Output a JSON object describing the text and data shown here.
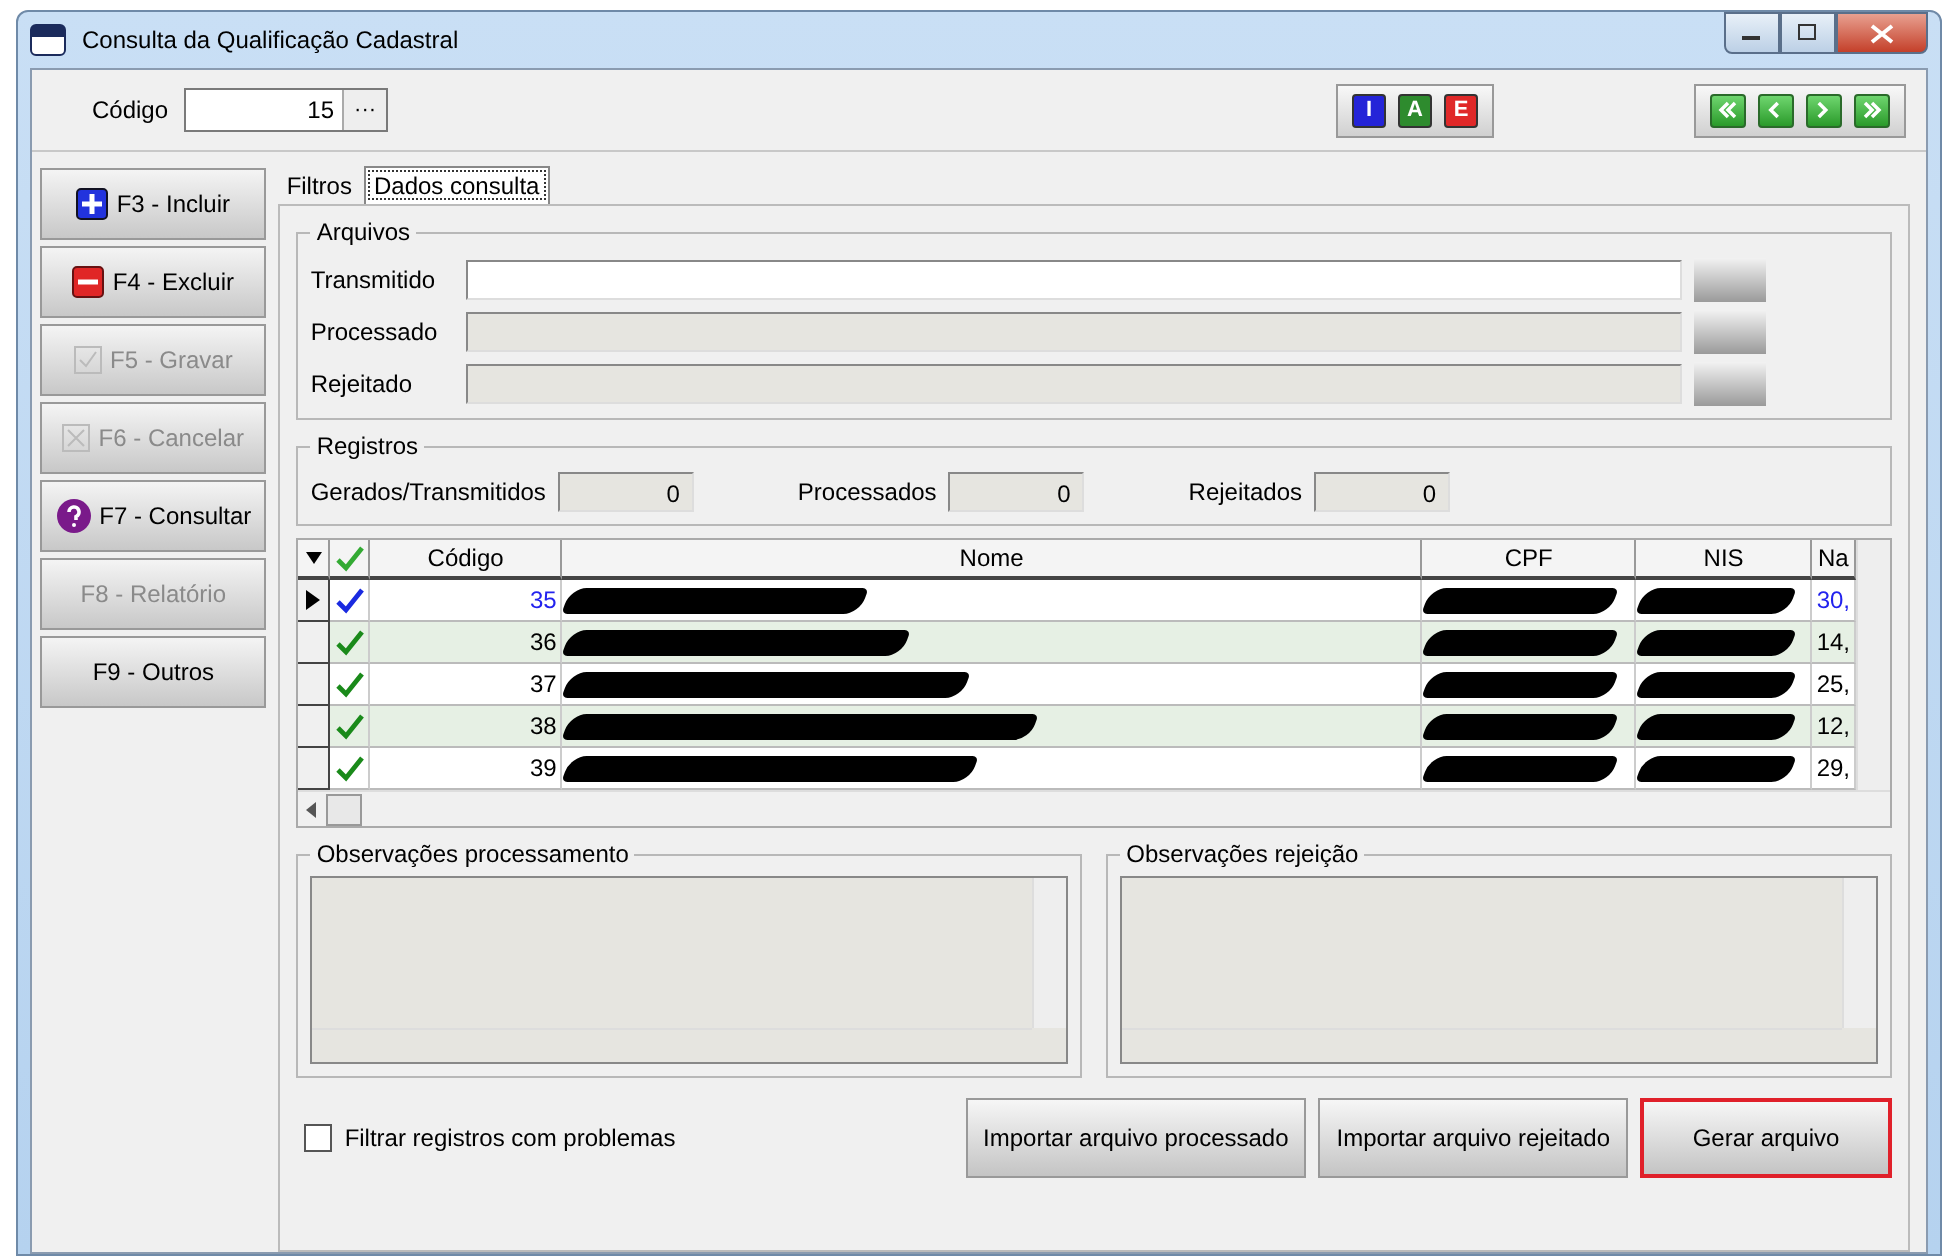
{
  "window": {
    "title": "Consulta da Qualificação Cadastral"
  },
  "codigo": {
    "label": "Código",
    "value": "15",
    "lookup": "···"
  },
  "record_buttons": [
    {
      "letter": "I",
      "color": "#2424d8"
    },
    {
      "letter": "A",
      "color": "#2e8b2e"
    },
    {
      "letter": "E",
      "color": "#e02828"
    }
  ],
  "nav_buttons": [
    {
      "kind": "first"
    },
    {
      "kind": "prev"
    },
    {
      "kind": "next"
    },
    {
      "kind": "last"
    }
  ],
  "sidebar": {
    "items": [
      {
        "label": "F3 - Incluir",
        "kind": "plus",
        "disabled": false
      },
      {
        "label": "F4 - Excluir",
        "kind": "minus",
        "disabled": false
      },
      {
        "label": "F5 - Gravar",
        "kind": "check",
        "disabled": true
      },
      {
        "label": "F6 - Cancelar",
        "kind": "cross",
        "disabled": true
      },
      {
        "label": "F7 - Consultar",
        "kind": "question",
        "disabled": false
      },
      {
        "label": "F8 - Relatório",
        "kind": "plain",
        "disabled": true
      },
      {
        "label": "F9 - Outros",
        "kind": "plain",
        "disabled": false
      }
    ]
  },
  "tabs": [
    {
      "label": "Filtros",
      "selected": false
    },
    {
      "label": "Dados consulta",
      "selected": true
    }
  ],
  "arquivos": {
    "title": "Arquivos",
    "fields": [
      {
        "label": "Transmitido",
        "disabled": false
      },
      {
        "label": "Processado",
        "disabled": true
      },
      {
        "label": "Rejeitado",
        "disabled": true
      }
    ]
  },
  "registros": {
    "title": "Registros",
    "counters": [
      {
        "label": "Gerados/Transmitidos",
        "value": "0"
      },
      {
        "label": "Processados",
        "value": "0"
      },
      {
        "label": "Rejeitados",
        "value": "0"
      }
    ]
  },
  "table": {
    "columns": [
      "Código",
      "Nome",
      "CPF",
      "NIS",
      "Na"
    ],
    "rows": [
      {
        "codigo": "35",
        "na": "30,",
        "selected": true,
        "checked": true
      },
      {
        "codigo": "36",
        "na": "14,",
        "selected": false,
        "checked": true
      },
      {
        "codigo": "37",
        "na": "25,",
        "selected": false,
        "checked": true
      },
      {
        "codigo": "38",
        "na": "12,",
        "selected": false,
        "checked": true
      },
      {
        "codigo": "39",
        "na": "29,",
        "selected": false,
        "checked": true
      }
    ]
  },
  "observations": [
    {
      "title": "Observações processamento"
    },
    {
      "title": "Observações rejeição"
    }
  ],
  "filter_checkbox": {
    "label": "Filtrar registros com problemas",
    "checked": false
  },
  "buttons": [
    {
      "label": "Importar arquivo processado",
      "highlighted": false
    },
    {
      "label": "Importar arquivo rejeitado",
      "highlighted": false
    },
    {
      "label": "Gerar arquivo",
      "highlighted": true
    }
  ]
}
